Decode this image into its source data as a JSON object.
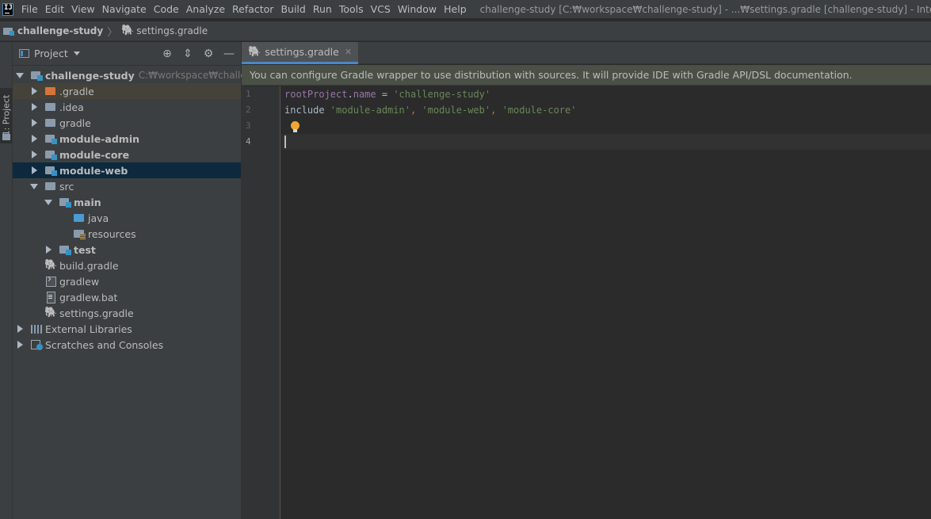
{
  "menubar": {
    "items": [
      "File",
      "Edit",
      "View",
      "Navigate",
      "Code",
      "Analyze",
      "Refactor",
      "Build",
      "Run",
      "Tools",
      "VCS",
      "Window",
      "Help"
    ],
    "window_title": "challenge-study [C:₩workspace₩challenge-study] - ...₩settings.gradle [challenge-study] - IntelliJ IDEA"
  },
  "breadcrumb": {
    "root": "challenge-study",
    "file": "settings.gradle"
  },
  "stripe": {
    "tab_label": "1: Project"
  },
  "project_panel": {
    "title": "Project",
    "tree": [
      {
        "label": "challenge-study",
        "hint": "C:₩workspace₩challenge-st",
        "bold": true,
        "icon": "module-folder-icon"
      },
      {
        "label": ".gradle",
        "icon": "folder-orange-icon"
      },
      {
        "label": ".idea",
        "icon": "folder-icon"
      },
      {
        "label": "gradle",
        "icon": "folder-icon"
      },
      {
        "label": "module-admin",
        "bold": true,
        "icon": "module-folder-icon"
      },
      {
        "label": "module-core",
        "bold": true,
        "icon": "module-folder-icon"
      },
      {
        "label": "module-web",
        "bold": true,
        "icon": "module-folder-icon",
        "selected": true
      },
      {
        "label": "src",
        "icon": "folder-icon"
      },
      {
        "label": "main",
        "bold": true,
        "icon": "module-folder-icon"
      },
      {
        "label": "java",
        "icon": "source-folder-icon"
      },
      {
        "label": "resources",
        "icon": "resources-folder-icon"
      },
      {
        "label": "test",
        "bold": true,
        "icon": "module-folder-icon"
      },
      {
        "label": "build.gradle",
        "icon": "gradle-elephant-icon"
      },
      {
        "label": "gradlew",
        "icon": "shell-script-icon"
      },
      {
        "label": "gradlew.bat",
        "icon": "batch-file-icon"
      },
      {
        "label": "settings.gradle",
        "icon": "gradle-elephant-icon"
      },
      {
        "label": "External Libraries",
        "icon": "libraries-icon"
      },
      {
        "label": "Scratches and Consoles",
        "icon": "scratches-icon"
      }
    ]
  },
  "editor": {
    "tab_label": "settings.gradle",
    "banner": "You can configure Gradle wrapper to use distribution with sources. It will provide IDE with Gradle API/DSL documentation.",
    "line_numbers": [
      "1",
      "2",
      "3",
      "4"
    ],
    "line1": {
      "ident": "rootProject",
      "dot": ".",
      "prop": "name",
      "eq": " = ",
      "str": "'challenge-study'"
    },
    "line2": {
      "kw": "include ",
      "s1": "'module-admin'",
      "c1": ", ",
      "s2": "'module-web'",
      "c2": ", ",
      "s3": "'module-core'"
    }
  },
  "colors": {
    "accent": "#4a88c7",
    "selection": "#0d293e",
    "banner_bg": "#4a5046",
    "string": "#6a8759",
    "property": "#9876aa"
  }
}
